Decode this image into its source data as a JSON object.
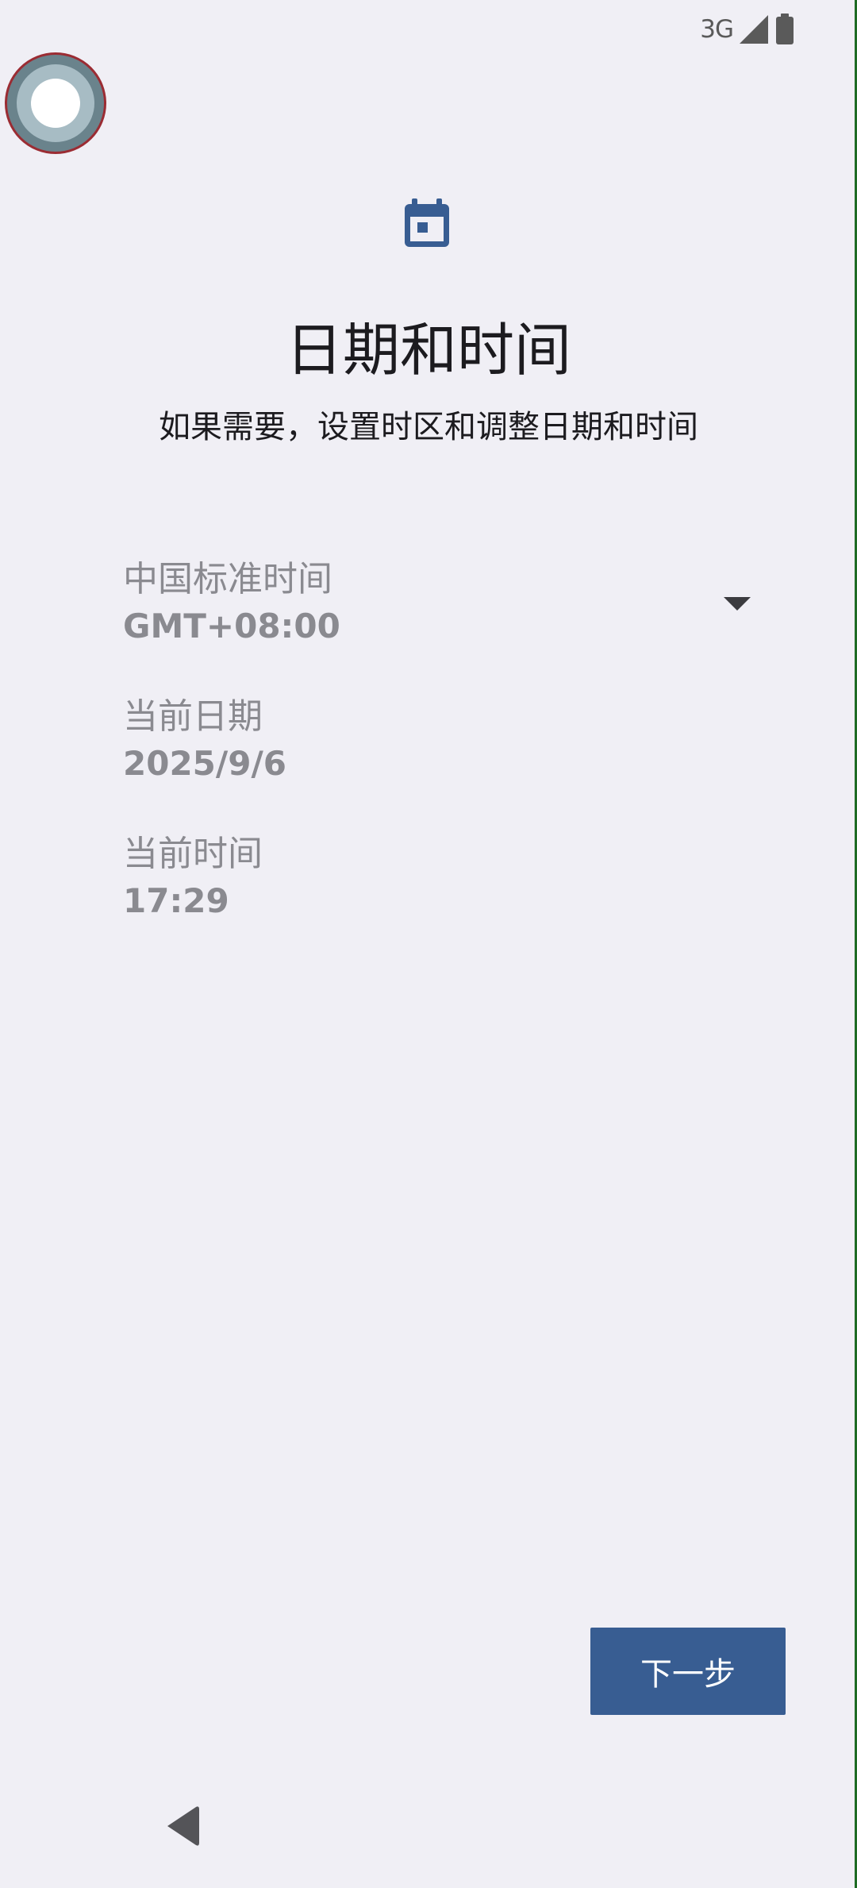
{
  "status_bar": {
    "network": "3G",
    "signal_icon": "signal-cellular-icon",
    "battery_icon": "battery-icon"
  },
  "floating_bubble": {
    "icon": "assistant-bubble-icon"
  },
  "header": {
    "icon": "calendar-icon",
    "title": "日期和时间",
    "subtitle": "如果需要，设置时区和调整日期和时间"
  },
  "settings": {
    "timezone": {
      "label": "中国标准时间",
      "value": "GMT+08:00",
      "dropdown_icon": "dropdown-arrow-icon"
    },
    "date": {
      "label": "当前日期",
      "value": "2025/9/6"
    },
    "time": {
      "label": "当前时间",
      "value": "17:29"
    }
  },
  "actions": {
    "next_label": "下一步"
  },
  "navigation": {
    "back_icon": "back-triangle-icon"
  },
  "colors": {
    "background": "#f0eff5",
    "accent": "#385d92",
    "secondary_text": "#8a8a90"
  }
}
